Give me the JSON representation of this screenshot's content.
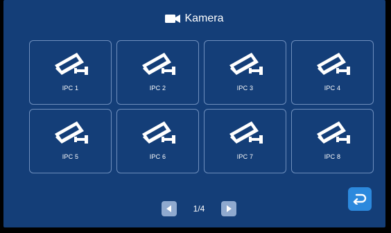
{
  "header": {
    "title": "Kamera",
    "icon": "video-camera-icon"
  },
  "cameras": [
    {
      "label": "IPC 1",
      "icon": "cctv-camera-icon"
    },
    {
      "label": "IPC 2",
      "icon": "cctv-camera-icon"
    },
    {
      "label": "IPC 3",
      "icon": "cctv-camera-icon"
    },
    {
      "label": "IPC 4",
      "icon": "cctv-camera-icon"
    },
    {
      "label": "IPC 5",
      "icon": "cctv-camera-icon"
    },
    {
      "label": "IPC 6",
      "icon": "cctv-camera-icon"
    },
    {
      "label": "IPC 7",
      "icon": "cctv-camera-icon"
    },
    {
      "label": "IPC 8",
      "icon": "cctv-camera-icon"
    }
  ],
  "pagination": {
    "page_text": "1/4",
    "prev_icon": "triangle-left-icon",
    "next_icon": "triangle-right-icon"
  },
  "back_button": {
    "icon": "return-arrow-icon"
  },
  "colors": {
    "background": "#143e78",
    "tile_border": "#6f8fbd",
    "pager_button": "#8fa9cf",
    "back_button": "#2c89dd",
    "text": "#ffffff"
  }
}
